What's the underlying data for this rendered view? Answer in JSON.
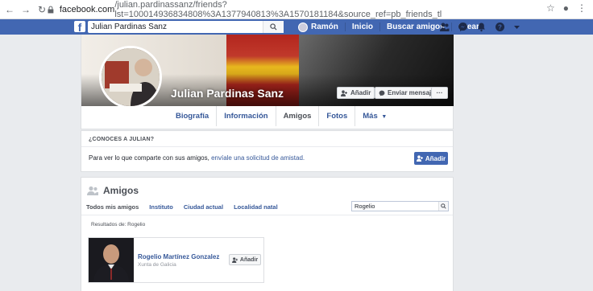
{
  "browser": {
    "url_host": "facebook.com",
    "url_rest": "/julian.pardinassanz/friends?lst=100014936834808%3A1377940813%3A1570181184&source_ref=pb_friends_tl"
  },
  "fb_header": {
    "search_value": "Julian Pardinas Sanz",
    "profile_name": "Ramón",
    "nav": [
      "Inicio",
      "Buscar amigos",
      "Crear"
    ],
    "brand_color": "#4267b2"
  },
  "profile": {
    "name": "Julian Pardinas Sanz",
    "add_label": "Añadir",
    "message_label": "Enviar mensaje",
    "more_label": "···",
    "tabs": [
      "Biografía",
      "Información",
      "Amigos",
      "Fotos",
      "Más"
    ]
  },
  "know": {
    "title": "¿CONOCES A JULIAN?",
    "text": "Para ver lo que comparte con sus amigos, ",
    "link": "envíale una solicitud de amistad.",
    "add_label": "Añadir"
  },
  "friends": {
    "title": "Amigos",
    "tabs": [
      "Todos mis amigos",
      "Instituto",
      "Ciudad actual",
      "Localidad natal"
    ],
    "search_value": "Rogelio",
    "results_label": "Resultados de: Rogelio",
    "card": {
      "name": "Rogelio Martínez Gonzalez",
      "subtitle": "Xunta de Galicia",
      "add_label": "Añadir"
    }
  }
}
